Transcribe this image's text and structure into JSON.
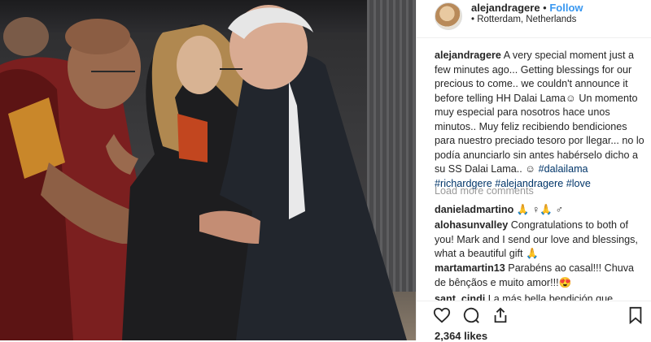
{
  "post": {
    "username": "alejandragere",
    "separator": "•",
    "follow_label": "Follow",
    "location": "Rotterdam, Netherlands",
    "caption_username": "alejandragere",
    "caption_text": " A very special moment just a few minutes ago... Getting blessings for our precious to come.. we couldn't announce it before telling HH Dalai Lama☺ Un momento muy especial para nosotros hace unos minutos.. Muy feliz recibiendo bendiciones para nuestro preciado tesoro por llegar... no lo podía anunciarlo sin antes habérselo dicho a su SS Dalai Lama.. ☺ ",
    "hashtags": [
      "#dalailama",
      "#richardgere",
      "#alejandragere",
      "#love"
    ],
    "load_more": "Load more comments",
    "comments": [
      {
        "user": "danieladmartino",
        "text": " 🙏 ♀🙏 ♂"
      },
      {
        "user": "alohasunvalley",
        "text": " Congratulations to both of you! Mark and I send our love and blessings, what a beautiful gift 🙏"
      },
      {
        "user": "martamartin13",
        "text": " Parabéns ao casal!!! Chuva de bênçãos e muito amor!!!😍"
      },
      {
        "user": "sant_cindi",
        "text": " La más bella bendición que"
      }
    ],
    "likes": "2,364 likes"
  },
  "icons": [
    "heart-icon",
    "comment-icon",
    "share-icon",
    "bookmark-icon",
    "location-pin-icon"
  ],
  "colors": {
    "link": "#003569",
    "follow": "#3897f0",
    "muted": "#999999"
  }
}
